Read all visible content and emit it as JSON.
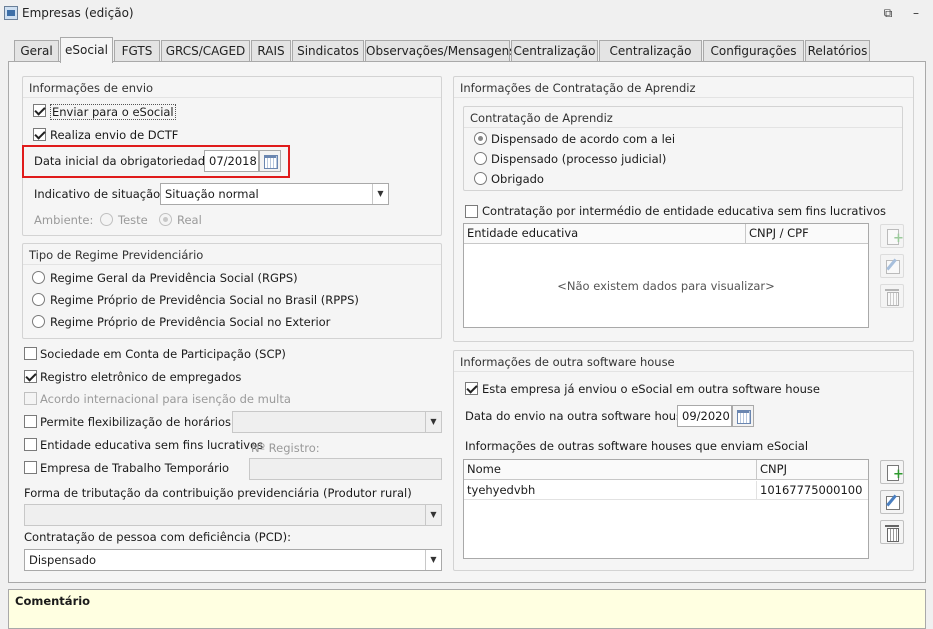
{
  "window": {
    "title": "Empresas (edição)",
    "restore_icon": "restore-icon",
    "minimize_icon": "minimize-icon"
  },
  "tabs": [
    "Geral",
    "eSocial",
    "FGTS",
    "GRCS/CAGED",
    "RAIS",
    "Sindicatos",
    "Observações/Mensagens",
    "Centralização",
    "Centralização CS",
    "Configurações",
    "Relatórios"
  ],
  "envio": {
    "title": "Informações de envio",
    "enviar_label": "Enviar para o eSocial",
    "enviar_checked": true,
    "dctf_label": "Realiza envio de DCTF",
    "dctf_checked": true,
    "data_label": "Data inicial da obrigatoriedade:",
    "data_value": "07/2018",
    "situacao_label": "Indicativo de situação:",
    "situacao_value": "Situação normal",
    "ambiente_label": "Ambiente:",
    "ambiente_teste": "Teste",
    "ambiente_real": "Real",
    "ambiente_selected": "Real"
  },
  "regime": {
    "title": "Tipo de Regime Previdenciário",
    "options": [
      "Regime Geral da Previdência Social (RGPS)",
      "Regime Próprio de Previdência Social no Brasil (RPPS)",
      "Regime Próprio de Previdência Social no Exterior"
    ]
  },
  "checks": {
    "scp": "Sociedade em Conta de Participação (SCP)",
    "registro": "Registro eletrônico de empregados",
    "acordo": "Acordo internacional para isenção de multa",
    "flex": "Permite flexibilização de horários",
    "entidade": "Entidade educativa sem fins lucrativos",
    "registro_no": "Nº Registro:",
    "temporario": "Empresa de Trabalho Temporário"
  },
  "tributacao": {
    "label": "Forma de tributação da contribuição previdenciária (Produtor rural)",
    "value": ""
  },
  "pcd": {
    "label": "Contratação de pessoa com deficiência (PCD):",
    "value": "Dispensado"
  },
  "aprendiz": {
    "title": "Informações de Contratação de Aprendiz",
    "sub_title": "Contratação de Aprendiz",
    "options": [
      "Dispensado de acordo com a lei",
      "Dispensado (processo judicial)",
      "Obrigado"
    ],
    "selected": 0,
    "intermedio_label": "Contratação por intermédio de entidade educativa sem fins lucrativos",
    "columns": [
      "Entidade educativa",
      "CNPJ / CPF"
    ],
    "empty_text": "<Não existem dados para visualizar>"
  },
  "software": {
    "title": "Informações de outra software house",
    "enviou_label": "Esta empresa já enviou o eSocial em outra software house",
    "enviou_checked": true,
    "data_label": "Data do envio na outra software house:",
    "data_value": "09/2020",
    "grid_title": "Informações de outras software houses que enviam eSocial",
    "columns": [
      "Nome",
      "CNPJ"
    ],
    "rows": [
      {
        "nome": "tyehyedvbh",
        "cnpj": "10167775000100"
      }
    ]
  },
  "comment": {
    "label": "Comentário"
  }
}
